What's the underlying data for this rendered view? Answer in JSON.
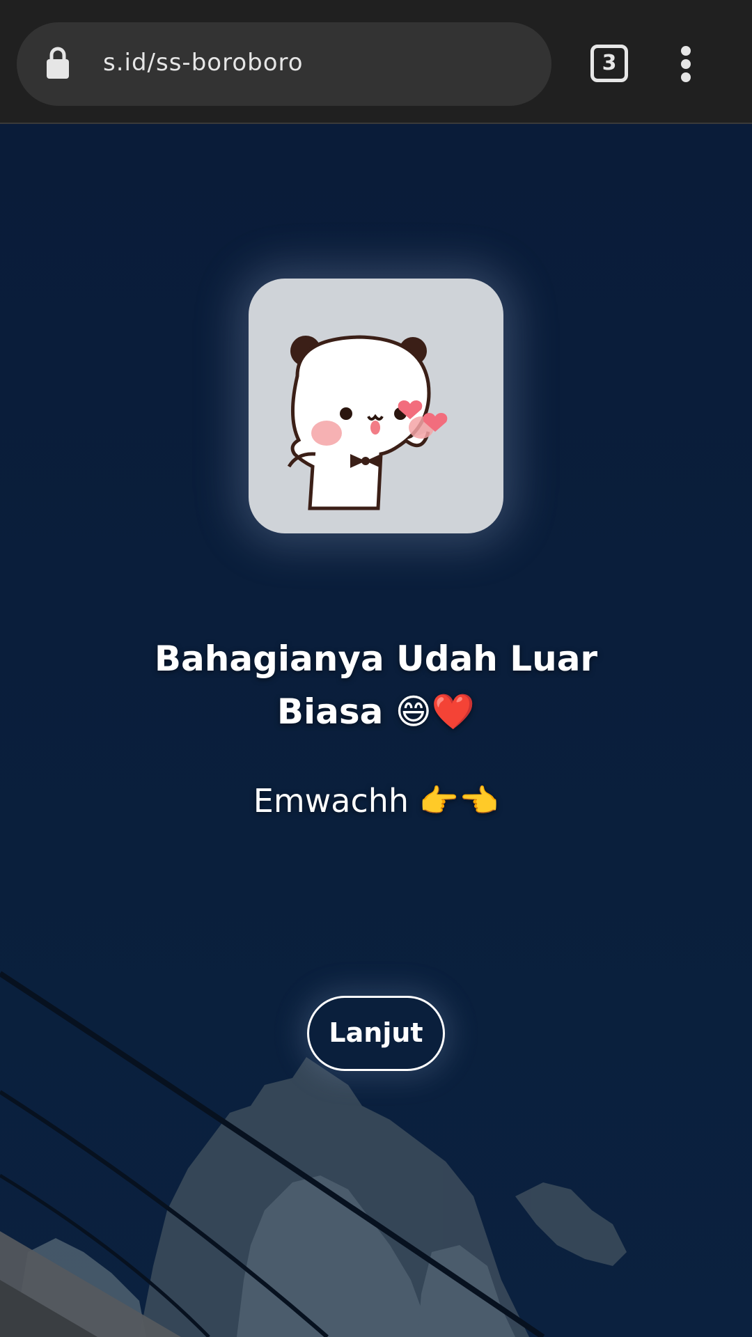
{
  "browser": {
    "url": "s.id/ss-boroboro",
    "tab_count": "3",
    "icons": {
      "lock": "lock-icon",
      "menu": "more-vert-icon"
    }
  },
  "content": {
    "headline": "Bahagianya Udah Luar Biasa 😄❤️",
    "subline": "Emwachh 👉👈",
    "next_button": "Lanjut",
    "sticker": "panda-sticker"
  },
  "colors": {
    "background": "#0a1f3c",
    "card": "#cfd3d8",
    "toolbar": "#202020"
  }
}
